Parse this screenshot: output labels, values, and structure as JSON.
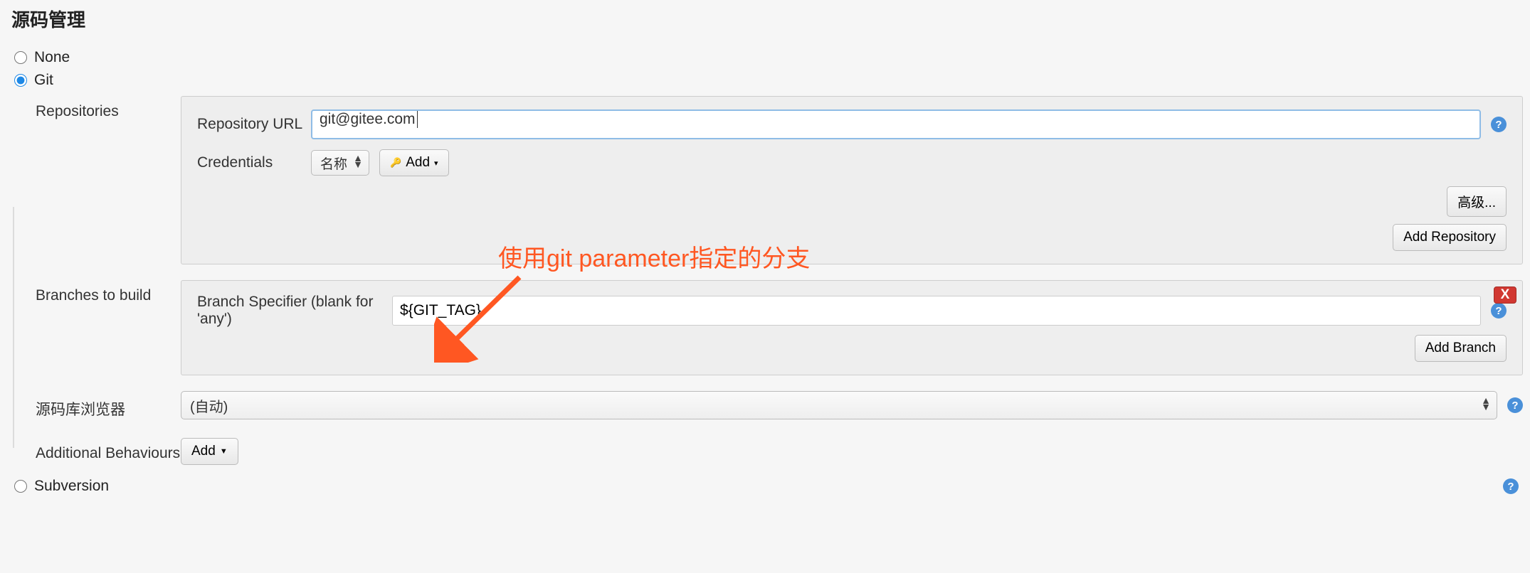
{
  "section_title": "源码管理",
  "scm_options": {
    "none": "None",
    "git": "Git",
    "svn": "Subversion"
  },
  "selected_scm": "git",
  "labels": {
    "repositories": "Repositories",
    "repo_url": "Repository URL",
    "credentials": "Credentials",
    "advanced": "高级...",
    "add_repository": "Add Repository",
    "branches_to_build": "Branches to build",
    "branch_specifier": "Branch Specifier (blank for 'any')",
    "add_branch": "Add Branch",
    "repo_browser": "源码库浏览器",
    "additional_behaviours": "Additional Behaviours",
    "add": "Add",
    "add_cred": "Add"
  },
  "values": {
    "repo_url": "git@gitee.com",
    "credentials_selected": "名称",
    "branch_specifier": "${GIT_TAG}",
    "repo_browser_selected": "(自动)"
  },
  "annotation": "使用git parameter指定的分支",
  "icons": {
    "help": "?",
    "delete": "X"
  }
}
